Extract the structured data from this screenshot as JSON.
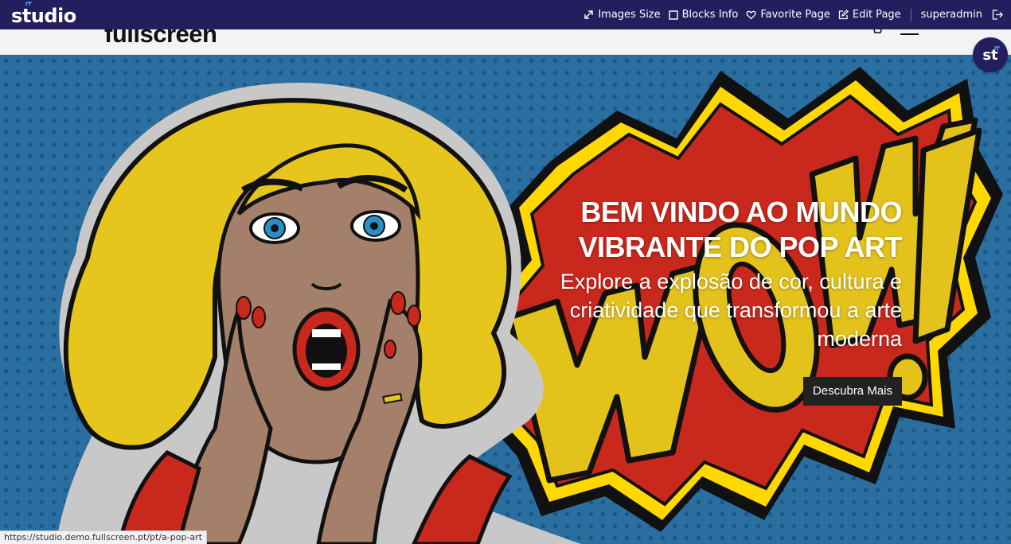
{
  "admin_bar": {
    "logo": "studio",
    "actions": [
      {
        "label": "Images Size",
        "icon": "expand-arrows-icon"
      },
      {
        "label": "Blocks Info",
        "icon": "square-icon"
      },
      {
        "label": "Favorite Page",
        "icon": "heart-icon"
      },
      {
        "label": "Edit Page",
        "icon": "edit-icon"
      }
    ],
    "user": "superadmin",
    "logout_icon": "logout-icon"
  },
  "site_header": {
    "brand": "fullscreen"
  },
  "hero": {
    "title": "BEM VINDO AO MUNDO VIBRANTE DO POP ART",
    "subtitle": "Explore a explosão de cor, cultura e criatividade que transformou a arte moderna",
    "cta": "Descubra Mais"
  },
  "studio_badge": "st",
  "status_url": "https://studio.demo.fullscreen.pt/pt/a-pop-art",
  "colors": {
    "admin_bar_bg": "#241e5e",
    "hero_bg": "#2b6fa1",
    "cta_bg": "#222222",
    "accent": "#3aa3e3"
  }
}
